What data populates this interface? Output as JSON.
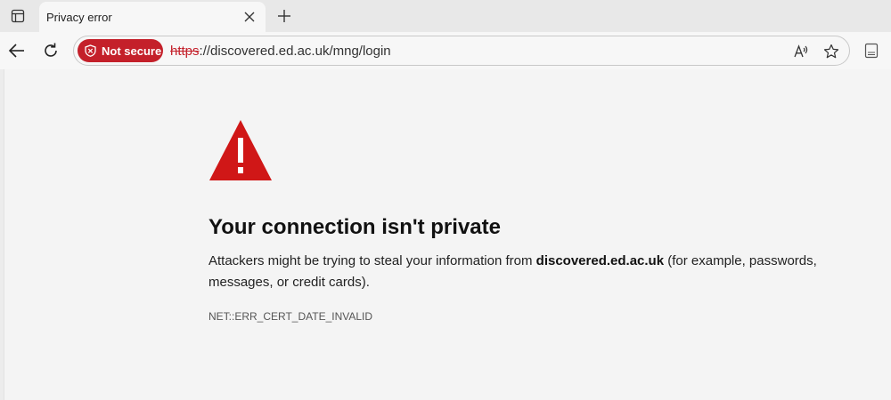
{
  "tab": {
    "title": "Privacy error"
  },
  "addressbar": {
    "security_label": "Not secure",
    "url_scheme": "https",
    "url_rest": "://discovered.ed.ac.uk/mng/login"
  },
  "error": {
    "heading": "Your connection isn't private",
    "message_before": "Attackers might be trying to steal your information from ",
    "domain": "discovered.ed.ac.uk",
    "message_after": " (for example, passwords, messages, or credit cards).",
    "code": "NET::ERR_CERT_DATE_INVALID"
  },
  "icons": [
    "tab-actions-icon",
    "close-icon",
    "plus-icon",
    "back-arrow-icon",
    "refresh-icon",
    "shield-icon",
    "read-aloud-icon",
    "star-icon",
    "sidebar-icon",
    "warning-icon"
  ],
  "colors": {
    "danger": "#c4202a",
    "warning_triangle": "#d01717",
    "page_bg": "#f4f4f4"
  }
}
